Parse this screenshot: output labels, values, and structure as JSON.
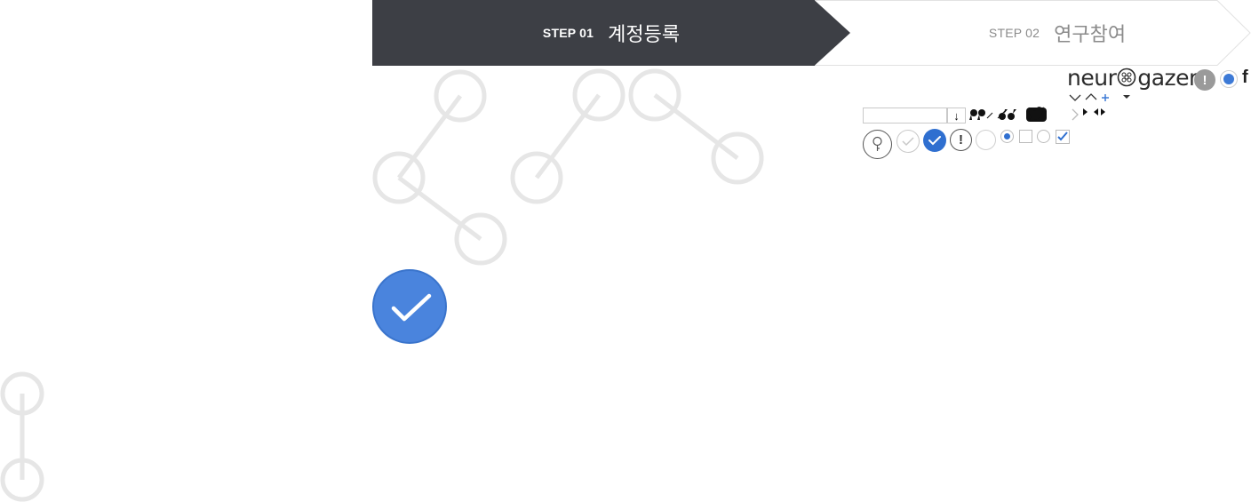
{
  "steps": [
    {
      "num": "STEP 01",
      "label": "계정등록",
      "state": "active"
    },
    {
      "num": "STEP 02",
      "label": "연구참여",
      "state": "inactive"
    }
  ],
  "logo": {
    "text_before": "neur",
    "text_after": "gazer"
  },
  "header_icons": {
    "facebook": "f"
  },
  "widgets": {
    "download_arrow": "↓",
    "exclaim": "!"
  },
  "icons": [
    "logo-brain-icon",
    "exclaim-icon",
    "radio-dot-icon",
    "facebook-icon",
    "chevron-down-icon",
    "chevron-up-icon",
    "plus-icon",
    "caret-down-icon",
    "quote-open-icon",
    "quote-close-icon",
    "youtube-icon",
    "twitter-icon",
    "chevron-right-icon",
    "play-right-icon",
    "play-left-icon",
    "key-icon",
    "check-icon",
    "checkbox-icon",
    "radio-icon"
  ],
  "colors": {
    "step_active_bg": "#3d3f45",
    "step_inactive_text": "#8b8b8b",
    "accent_blue": "#4a84dd",
    "deco_grey": "#e6e6e6"
  }
}
